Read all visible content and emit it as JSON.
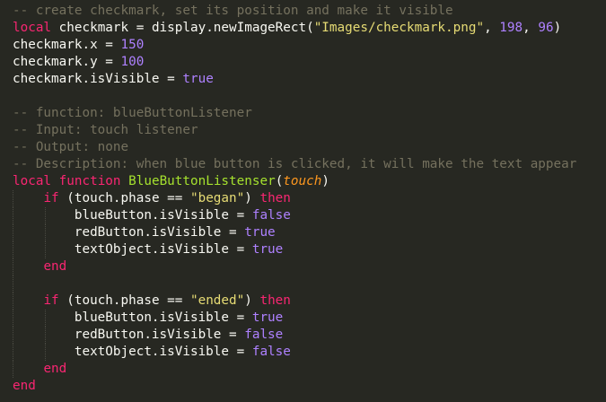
{
  "colors": {
    "background": "#272822",
    "plain": "#f8f8f2",
    "comment": "#75715e",
    "keyword": "#f92672",
    "function": "#a6e22e",
    "param": "#fd971f",
    "string": "#e6db74",
    "number": "#ae81ff",
    "constant": "#ae81ff",
    "guide": "#4a4a42"
  },
  "lines": [
    {
      "indent": 0,
      "tokens": [
        {
          "t": "-- create checkmark, set its position and make it visible",
          "k": "comment"
        }
      ]
    },
    {
      "indent": 0,
      "tokens": [
        {
          "t": "local",
          "k": "keyword"
        },
        {
          "t": " checkmark = display.newImageRect(",
          "k": "plain"
        },
        {
          "t": "\"Images/checkmark.png\"",
          "k": "string"
        },
        {
          "t": ", ",
          "k": "plain"
        },
        {
          "t": "198",
          "k": "number"
        },
        {
          "t": ", ",
          "k": "plain"
        },
        {
          "t": "96",
          "k": "number"
        },
        {
          "t": ")",
          "k": "plain"
        }
      ]
    },
    {
      "indent": 0,
      "tokens": [
        {
          "t": "checkmark.x = ",
          "k": "plain"
        },
        {
          "t": "150",
          "k": "number"
        }
      ]
    },
    {
      "indent": 0,
      "tokens": [
        {
          "t": "checkmark.y = ",
          "k": "plain"
        },
        {
          "t": "100",
          "k": "number"
        }
      ]
    },
    {
      "indent": 0,
      "tokens": [
        {
          "t": "checkmark.isVisible = ",
          "k": "plain"
        },
        {
          "t": "true",
          "k": "constant"
        }
      ]
    },
    {
      "indent": 0,
      "tokens": []
    },
    {
      "indent": 0,
      "tokens": [
        {
          "t": "-- function: blueButtonListener",
          "k": "comment"
        }
      ]
    },
    {
      "indent": 0,
      "tokens": [
        {
          "t": "-- Input: touch listener",
          "k": "comment"
        }
      ]
    },
    {
      "indent": 0,
      "tokens": [
        {
          "t": "-- Output: none",
          "k": "comment"
        }
      ]
    },
    {
      "indent": 0,
      "tokens": [
        {
          "t": "-- Description: when blue button is clicked, it will make the text appear",
          "k": "comment"
        }
      ]
    },
    {
      "indent": 0,
      "tokens": [
        {
          "t": "local",
          "k": "keyword"
        },
        {
          "t": " ",
          "k": "plain"
        },
        {
          "t": "function",
          "k": "keyword"
        },
        {
          "t": " ",
          "k": "plain"
        },
        {
          "t": "BlueButtonListenser",
          "k": "function"
        },
        {
          "t": "(",
          "k": "plain"
        },
        {
          "t": "touch",
          "k": "param"
        },
        {
          "t": ")",
          "k": "plain"
        }
      ]
    },
    {
      "indent": 1,
      "tokens": [
        {
          "t": "    ",
          "k": "plain"
        },
        {
          "t": "if",
          "k": "keyword"
        },
        {
          "t": " (touch.phase == ",
          "k": "plain"
        },
        {
          "t": "\"began\"",
          "k": "string"
        },
        {
          "t": ") ",
          "k": "plain"
        },
        {
          "t": "then",
          "k": "keyword"
        }
      ]
    },
    {
      "indent": 2,
      "tokens": [
        {
          "t": "        blueButton.isVisible = ",
          "k": "plain"
        },
        {
          "t": "false",
          "k": "constant"
        }
      ]
    },
    {
      "indent": 2,
      "tokens": [
        {
          "t": "        redButton.isVisible = ",
          "k": "plain"
        },
        {
          "t": "true",
          "k": "constant"
        }
      ]
    },
    {
      "indent": 2,
      "tokens": [
        {
          "t": "        textObject.isVisible = ",
          "k": "plain"
        },
        {
          "t": "true",
          "k": "constant"
        }
      ]
    },
    {
      "indent": 1,
      "tokens": [
        {
          "t": "    ",
          "k": "plain"
        },
        {
          "t": "end",
          "k": "keyword"
        }
      ]
    },
    {
      "indent": 1,
      "tokens": []
    },
    {
      "indent": 1,
      "tokens": [
        {
          "t": "    ",
          "k": "plain"
        },
        {
          "t": "if",
          "k": "keyword"
        },
        {
          "t": " (touch.phase == ",
          "k": "plain"
        },
        {
          "t": "\"ended\"",
          "k": "string"
        },
        {
          "t": ") ",
          "k": "plain"
        },
        {
          "t": "then",
          "k": "keyword"
        }
      ]
    },
    {
      "indent": 2,
      "tokens": [
        {
          "t": "        blueButton.isVisible = ",
          "k": "plain"
        },
        {
          "t": "true",
          "k": "constant"
        }
      ]
    },
    {
      "indent": 2,
      "tokens": [
        {
          "t": "        redButton.isVisible = ",
          "k": "plain"
        },
        {
          "t": "false",
          "k": "constant"
        }
      ]
    },
    {
      "indent": 2,
      "tokens": [
        {
          "t": "        textObject.isVisible = ",
          "k": "plain"
        },
        {
          "t": "false",
          "k": "constant"
        }
      ]
    },
    {
      "indent": 1,
      "tokens": [
        {
          "t": "    ",
          "k": "plain"
        },
        {
          "t": "end",
          "k": "keyword"
        }
      ]
    },
    {
      "indent": 0,
      "tokens": [
        {
          "t": "end",
          "k": "keyword"
        }
      ]
    }
  ]
}
